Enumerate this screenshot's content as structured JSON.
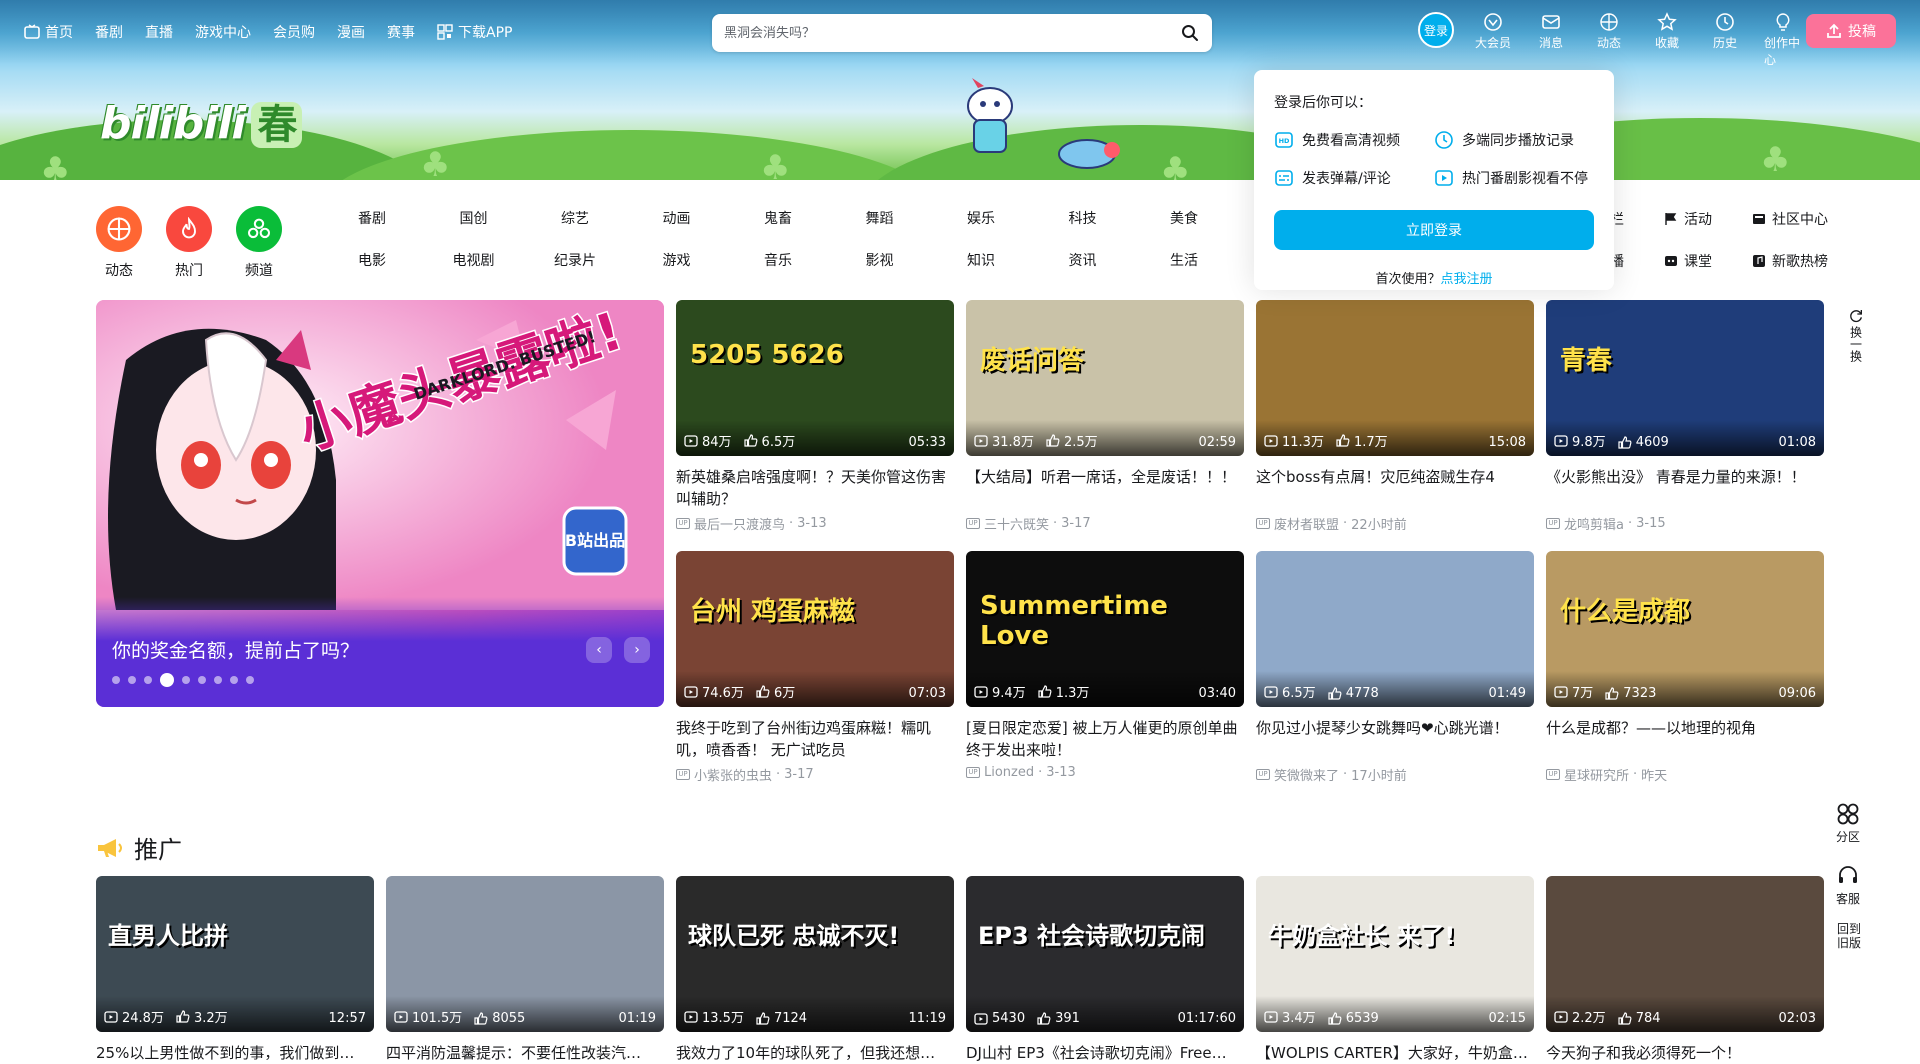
{
  "nav": {
    "left": [
      {
        "label": "首页",
        "icon": "tv-icon"
      },
      {
        "label": "番剧"
      },
      {
        "label": "直播"
      },
      {
        "label": "游戏中心"
      },
      {
        "label": "会员购"
      },
      {
        "label": "漫画"
      },
      {
        "label": "赛事"
      },
      {
        "label": "下载APP",
        "icon": "download-app-icon"
      }
    ],
    "search_placeholder": "黑洞会消失吗？",
    "login_label": "登录",
    "right": [
      {
        "label": "大会员",
        "icon": "vip-icon"
      },
      {
        "label": "消息",
        "icon": "message-icon"
      },
      {
        "label": "动态",
        "icon": "dynamic-icon"
      },
      {
        "label": "收藏",
        "icon": "star-icon"
      },
      {
        "label": "历史",
        "icon": "history-icon"
      },
      {
        "label": "创作中心",
        "icon": "bulb-icon"
      }
    ],
    "upload_label": "投稿"
  },
  "logo": {
    "text": "bilibili",
    "badge": "春"
  },
  "big_channels": [
    {
      "label": "动态",
      "color": "#ff6633"
    },
    {
      "label": "热门",
      "color": "#f9483e"
    },
    {
      "label": "频道",
      "color": "#0abd39"
    }
  ],
  "channels": [
    "番剧",
    "国创",
    "综艺",
    "动画",
    "鬼畜",
    "舞蹈",
    "娱乐",
    "科技",
    "美食",
    "电影",
    "电视剧",
    "纪录片",
    "游戏",
    "音乐",
    "影视",
    "知识",
    "资讯",
    "生活"
  ],
  "channels_side": [
    {
      "label": "专栏"
    },
    {
      "label": "活动",
      "icon": "flag-icon"
    },
    {
      "label": "社区中心",
      "icon": "community-icon"
    },
    {
      "label": "直播"
    },
    {
      "label": "课堂",
      "icon": "class-icon"
    },
    {
      "label": "新歌热榜",
      "icon": "music-chart-icon"
    }
  ],
  "login_popup": {
    "title": "登录后你可以：",
    "perks": [
      {
        "label": "免费看高清视频",
        "icon": "hd-icon"
      },
      {
        "label": "多端同步播放记录",
        "icon": "clock-icon"
      },
      {
        "label": "发表弹幕/评论",
        "icon": "danmaku-icon"
      },
      {
        "label": "热门番剧影视看不停",
        "icon": "play-icon"
      }
    ],
    "button": "立即登录",
    "register_prompt": "首次使用？",
    "register_link": "点我注册"
  },
  "carousel": {
    "title": "你的奖金名额，提前占了吗？",
    "art_text": "小魔头暴露啦!",
    "art_sub": "DARKLORD. BUSTED!",
    "badge": "B站出品",
    "dots": 9,
    "active_dot": 3
  },
  "videos": [
    {
      "title": "新英雄桑启啥强度啊！？天美你管这伤害叫辅助？",
      "views": "84万",
      "likes": "6.5万",
      "duration": "05:33",
      "up": "最后一只渡渡鸟",
      "date": "3-13",
      "bg": "#2c4a1e",
      "overlay": "5205 5626"
    },
    {
      "title": "【大结局】听君一席话，全是废话！！！",
      "views": "31.8万",
      "likes": "2.5万",
      "duration": "02:59",
      "up": "三十六既笑",
      "date": "3-17",
      "bg": "#c9c2a8",
      "overlay": "废话问答"
    },
    {
      "title": "这个boss有点屑！灾厄纯盗贼生存4",
      "views": "11.3万",
      "likes": "1.7万",
      "duration": "15:08",
      "up": "废材者联盟",
      "date": "22小时前",
      "bg": "#9a7434",
      "overlay": ""
    },
    {
      "title": "《火影熊出没》 青春是力量的来源！！",
      "views": "9.8万",
      "likes": "4609",
      "duration": "01:08",
      "up": "龙鸣剪辑a",
      "date": "3-15",
      "bg": "#1f3d7a",
      "overlay": "青春"
    },
    {
      "title": "我终于吃到了台州街边鸡蛋麻糍！糯叽叽，喷香香！ 无广试吃员",
      "views": "74.6万",
      "likes": "6万",
      "duration": "07:03",
      "up": "小紫张的虫虫",
      "date": "3-17",
      "bg": "#7a4434",
      "overlay": "台州 鸡蛋麻糍"
    },
    {
      "title": "[夏日限定恋爱] 被上万人催更的原创单曲终于发出来啦！",
      "views": "9.4万",
      "likes": "1.3万",
      "duration": "03:40",
      "up": "Lionzed",
      "date": "3-13",
      "bg": "#0d0d0d",
      "overlay": "Summertime Love"
    },
    {
      "title": "你见过小提琴少女跳舞吗❤心跳光谱！",
      "views": "6.5万",
      "likes": "4778",
      "duration": "01:49",
      "up": "笑微微来了",
      "date": "17小时前",
      "bg": "#8fa9c9",
      "overlay": ""
    },
    {
      "title": "什么是成都？——以地理的视角",
      "views": "7万",
      "likes": "7323",
      "duration": "09:06",
      "up": "星球研究所",
      "date": "昨天",
      "bg": "#b99a63",
      "overlay": "什么是成都"
    }
  ],
  "promo_title": "推广",
  "promo": [
    {
      "views": "24.8万",
      "likes": "3.2万",
      "duration": "12:57",
      "bg": "#3d4a53",
      "overlay": "直男人比拼"
    },
    {
      "views": "101.5万",
      "likes": "8055",
      "duration": "01:19",
      "bg": "#8b96a6",
      "overlay": ""
    },
    {
      "views": "13.5万",
      "likes": "7124",
      "duration": "11:19",
      "bg": "#2a2a2a",
      "overlay": "球队已死 忠诚不灭!"
    },
    {
      "views": "5430",
      "likes": "391",
      "duration": "01:17:60",
      "bg": "#2b2b2e",
      "overlay": "EP3 社会诗歌切克闹"
    },
    {
      "views": "3.4万",
      "likes": "6539",
      "duration": "02:15",
      "bg": "#e9e7e0",
      "overlay": "牛奶盒社长 来了!"
    },
    {
      "views": "2.2万",
      "likes": "784",
      "duration": "02:03",
      "bg": "#5a4a3e",
      "overlay": ""
    }
  ],
  "promo_titles_partial": [
    "25%以上男性做不到的事，我们做到…",
    "四平消防温馨提示：不要任性改装汽…",
    "我效力了10年的球队死了，但我还想…",
    "DJ山村 EP3《社会诗歌切克闹》Free…",
    "【WOLPIS CARTER】大家好，牛奶盒…",
    "今天狗子和我必须得死一个！"
  ],
  "right_float": [
    {
      "label": "换一换",
      "icon": "refresh-icon"
    },
    {
      "label": "分区",
      "icon": "grid-icon"
    },
    {
      "label": "客服",
      "icon": "headset-icon"
    },
    {
      "label": "回到旧版",
      "icon": "old-version-icon"
    }
  ]
}
